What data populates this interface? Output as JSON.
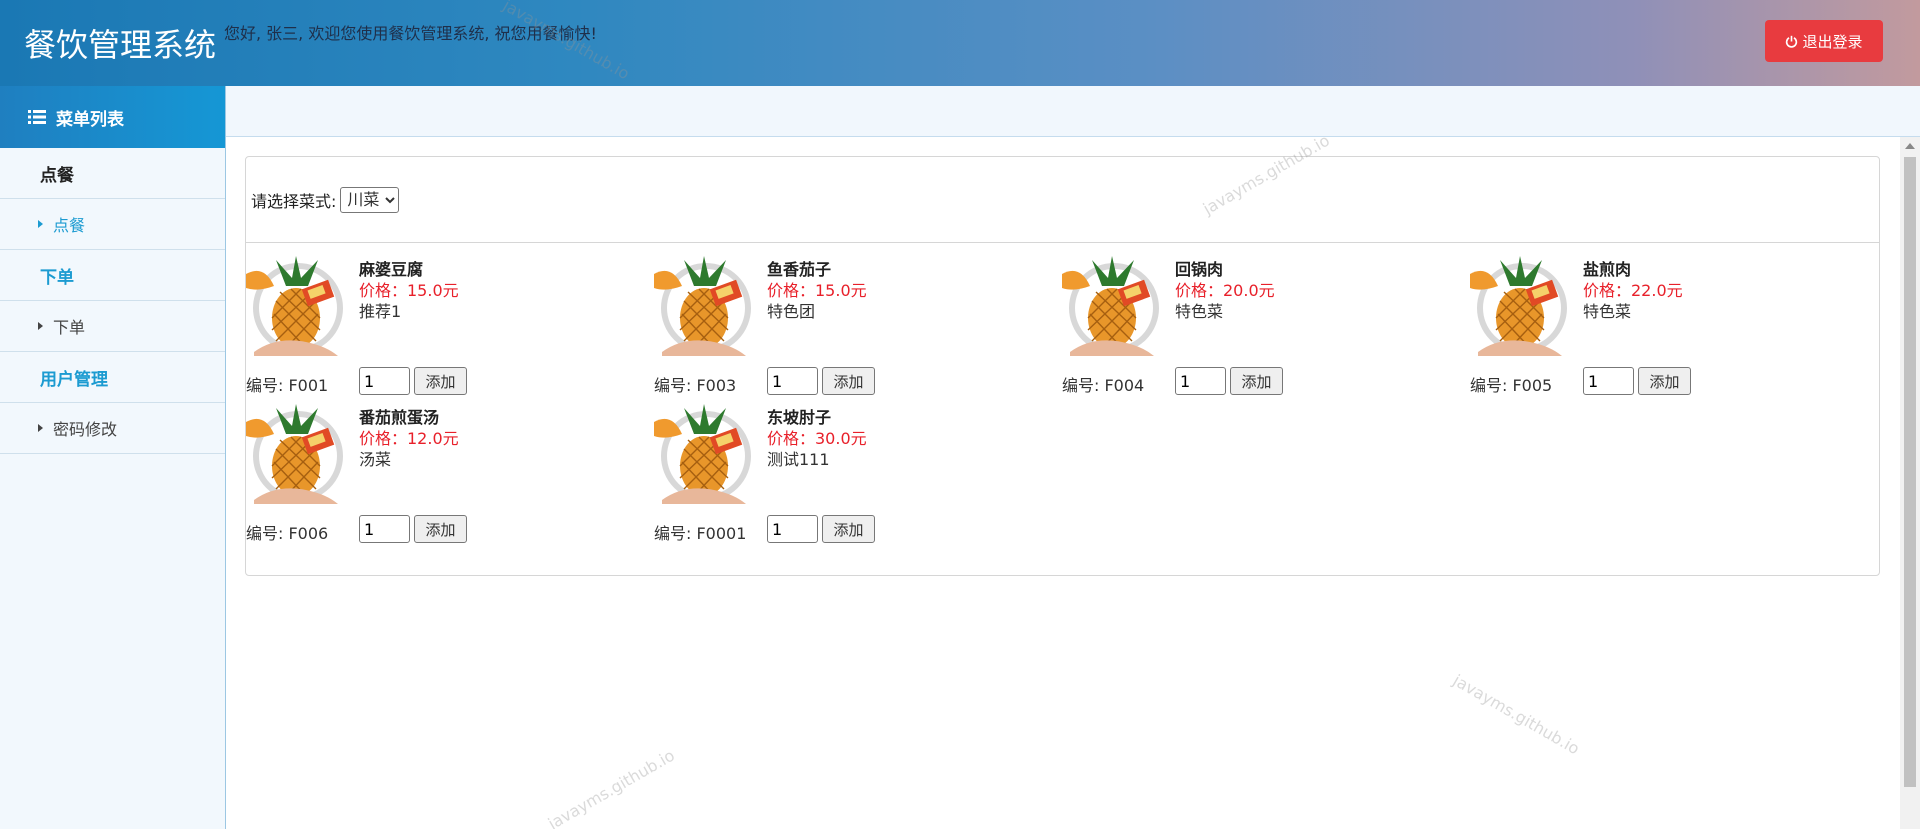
{
  "header": {
    "title": "餐饮管理系统",
    "welcome": "您好, 张三, 欢迎您使用餐饮管理系统, 祝您用餐愉快!",
    "logout_label": "退出登录"
  },
  "sidebar": {
    "header": "菜单列表",
    "groups": [
      {
        "label": "点餐",
        "items": [
          "点餐"
        ]
      },
      {
        "label": "下单",
        "items": [
          "下单"
        ]
      },
      {
        "label": "用户管理",
        "items": [
          "密码修改"
        ]
      }
    ]
  },
  "filter": {
    "label": "请选择菜式:",
    "selected": "川菜"
  },
  "dishes": [
    {
      "name": "麻婆豆腐",
      "price": "价格：15.0元",
      "desc": "推荐1",
      "code": "编号: F001",
      "qty": "1",
      "add": "添加"
    },
    {
      "name": "鱼香茄子",
      "price": "价格：15.0元",
      "desc": "特色团",
      "code": "编号: F003",
      "qty": "1",
      "add": "添加"
    },
    {
      "name": "回锅肉",
      "price": "价格：20.0元",
      "desc": "特色菜",
      "code": "编号: F004",
      "qty": "1",
      "add": "添加"
    },
    {
      "name": "盐煎肉",
      "price": "价格：22.0元",
      "desc": "特色菜",
      "code": "编号: F005",
      "qty": "1",
      "add": "添加"
    },
    {
      "name": "番茄煎蛋汤",
      "price": "价格：12.0元",
      "desc": "汤菜",
      "code": "编号: F006",
      "qty": "1",
      "add": "添加"
    },
    {
      "name": "东坡肘子",
      "price": "价格：30.0元",
      "desc": "测试111",
      "code": "编号: F0001",
      "qty": "1",
      "add": "添加"
    }
  ],
  "watermark": "javayms.github.io",
  "colors": {
    "accent": "#1c9bd1",
    "danger": "#e83b3f",
    "price": "#e8202a"
  }
}
